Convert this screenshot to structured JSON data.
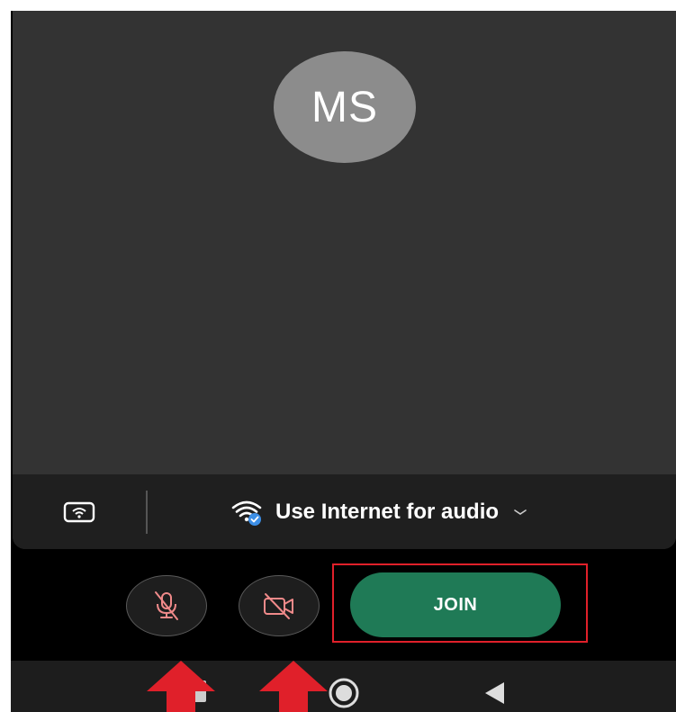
{
  "preview": {
    "avatar_initials": "MS"
  },
  "audio_bar": {
    "audio_option_label": "Use Internet for audio",
    "device_icon": "cast-device-icon",
    "wifi_icon": "wifi-check-icon",
    "dropdown_icon": "chevron-down-icon"
  },
  "controls": {
    "mic_icon": "mic-off-icon",
    "camera_icon": "camera-off-icon",
    "join_label": "JOIN"
  },
  "colors": {
    "join_green": "#1f7a56",
    "muted_icon_red": "#f08a8a",
    "annotation_red": "#e0202a",
    "wifi_check_blue": "#3d8fe6"
  },
  "annotations": {
    "arrow_icon": "up-arrow-icon",
    "highlight": "join-button-highlight"
  },
  "nav": {
    "recents_icon": "recents-icon",
    "home_icon": "home-icon",
    "back_icon": "back-icon"
  }
}
